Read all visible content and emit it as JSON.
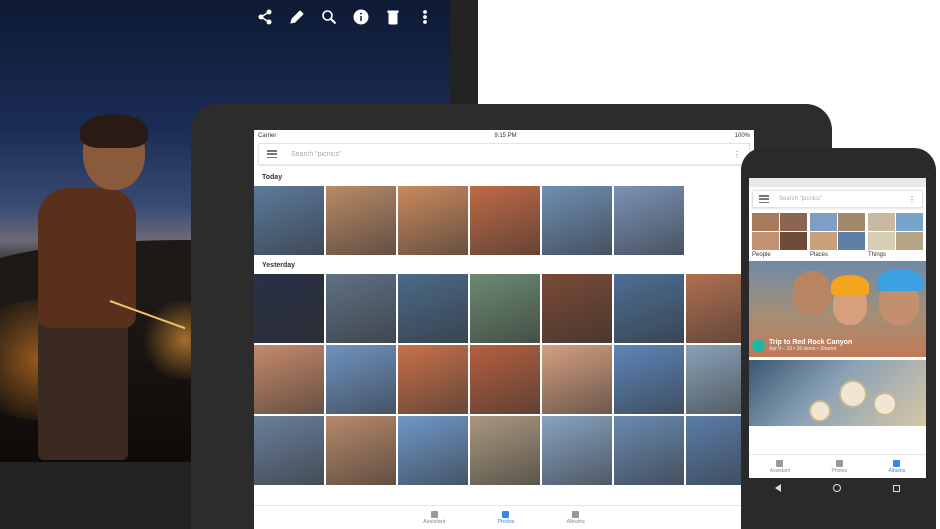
{
  "laptop": {
    "toolbar_icons": [
      "share-icon",
      "edit-icon",
      "zoom-icon",
      "info-icon",
      "delete-icon",
      "more-icon"
    ]
  },
  "tablet": {
    "status": {
      "carrier": "Carrier",
      "time": "9:15 PM",
      "battery": "100%"
    },
    "search": {
      "placeholder": "Search \"picnics\""
    },
    "sections": [
      {
        "label": "Today",
        "rows": [
          [
            "#5c7a9a",
            "#b98a66",
            "#c98a5e",
            "#c06a45",
            "#6f8fb3",
            "#7a93b5"
          ]
        ]
      },
      {
        "label": "Yesterday",
        "rows": [
          [
            "#2a3146",
            "#5f7184",
            "#4b6a88",
            "#6c8a72",
            "#7a4a36",
            "#4d6f93",
            "#b07050"
          ],
          [
            "#c58a6a",
            "#6f93c0",
            "#c8714a",
            "#b5603f",
            "#d49f80",
            "#5d86b8",
            "#8aa2b6"
          ],
          [
            "#6a7f9a",
            "#b7896a",
            "#6f98c8",
            "#a99880",
            "#87a3c0",
            "#6a8ab0",
            "#5b7da8"
          ]
        ]
      }
    ],
    "nav": [
      {
        "label": "Assistant"
      },
      {
        "label": "Photos"
      },
      {
        "label": "Albums"
      }
    ]
  },
  "phone": {
    "search": {
      "placeholder": "Search \"picnics\""
    },
    "categories": [
      {
        "label": "People",
        "colors": [
          "#a77a5b",
          "#8c6550",
          "#c29274",
          "#6d4c3a"
        ]
      },
      {
        "label": "Places",
        "colors": [
          "#7f9ec4",
          "#a3896b",
          "#c9a07a",
          "#5f7fa6"
        ]
      },
      {
        "label": "Things",
        "colors": [
          "#c9b9a0",
          "#7aa3c9",
          "#d8cdb5",
          "#b5a486"
        ]
      }
    ],
    "card": {
      "title": "Trip to Red Rock Canyon",
      "subtitle": "Apr 9 – 10 • 26 items • Shared"
    },
    "nav": [
      {
        "label": "Assistant"
      },
      {
        "label": "Photos"
      },
      {
        "label": "Albums"
      }
    ]
  },
  "colors": {
    "accent": "#3b82f0",
    "device": "#2c2c2c"
  }
}
